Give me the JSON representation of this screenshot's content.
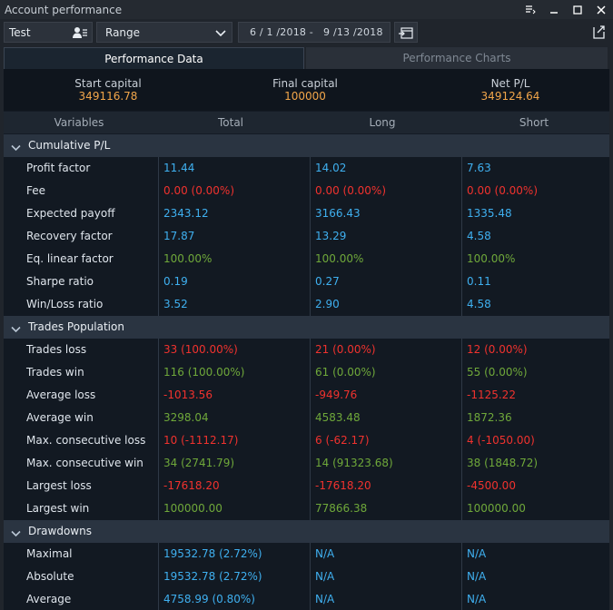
{
  "window": {
    "title": "Account performance"
  },
  "toolbar": {
    "account": "Test",
    "range_mode": "Range",
    "date_range": "6 / 1 /2018 -   9 /13 /2018"
  },
  "tabs": [
    {
      "label": "Performance Data",
      "active": true
    },
    {
      "label": "Performance Charts",
      "active": false
    }
  ],
  "summary": {
    "start_capital_label": "Start capital",
    "start_capital_value": "349116.78",
    "final_capital_label": "Final capital",
    "final_capital_value": "100000",
    "net_pl_label": "Net P/L",
    "net_pl_value": "349124.64"
  },
  "columns": [
    "Variables",
    "Total",
    "Long",
    "Short"
  ],
  "colors": {
    "blue": "#3fb0f0",
    "red": "#f0322e",
    "green": "#6fa83a",
    "orange": "#f2a64a"
  },
  "sections": [
    {
      "label": "Cumulative P/L",
      "rows": [
        {
          "name": "Profit factor",
          "total": "11.44",
          "long": "14.02",
          "short": "7.63",
          "color": "blue"
        },
        {
          "name": "Fee",
          "total": "0.00 (0.00%)",
          "long": "0.00 (0.00%)",
          "short": "0.00 (0.00%)",
          "color": "red"
        },
        {
          "name": "Expected payoff",
          "total": "2343.12",
          "long": "3166.43",
          "short": "1335.48",
          "color": "blue"
        },
        {
          "name": "Recovery factor",
          "total": "17.87",
          "long": "13.29",
          "short": "4.58",
          "color": "blue"
        },
        {
          "name": "Eq. linear factor",
          "total": "100.00%",
          "long": "100.00%",
          "short": "100.00%",
          "color": "green"
        },
        {
          "name": "Sharpe ratio",
          "total": "0.19",
          "long": "0.27",
          "short": "0.11",
          "color": "blue"
        },
        {
          "name": "Win/Loss ratio",
          "total": "3.52",
          "long": "2.90",
          "short": "4.58",
          "color": "blue"
        }
      ]
    },
    {
      "label": "Trades Population",
      "rows": [
        {
          "name": "Trades loss",
          "total": "33 (100.00%)",
          "long": "21 (0.00%)",
          "short": "12 (0.00%)",
          "color": "red"
        },
        {
          "name": "Trades win",
          "total": "116 (100.00%)",
          "long": "61 (0.00%)",
          "short": "55 (0.00%)",
          "color": "green"
        },
        {
          "name": "Average loss",
          "total": "-1013.56",
          "long": "-949.76",
          "short": "-1125.22",
          "color": "red"
        },
        {
          "name": "Average win",
          "total": "3298.04",
          "long": "4583.48",
          "short": "1872.36",
          "color": "green"
        },
        {
          "name": "Max. consecutive loss",
          "total": "10 (-1112.17)",
          "long": "6 (-62.17)",
          "short": "4 (-1050.00)",
          "color": "red"
        },
        {
          "name": "Max. consecutive win",
          "total": "34 (2741.79)",
          "long": "14 (91323.68)",
          "short": "38 (1848.72)",
          "color": "green"
        },
        {
          "name": "Largest loss",
          "total": "-17618.20",
          "long": "-17618.20",
          "short": "-4500.00",
          "color": "red"
        },
        {
          "name": "Largest win",
          "total": "100000.00",
          "long": "77866.38",
          "short": "100000.00",
          "color": "green"
        }
      ]
    },
    {
      "label": "Drawdowns",
      "rows": [
        {
          "name": "Maximal",
          "total": "19532.78 (2.72%)",
          "long": "N/A",
          "short": "N/A",
          "color": "blue"
        },
        {
          "name": "Absolute",
          "total": "19532.78 (2.72%)",
          "long": "N/A",
          "short": "N/A",
          "color": "blue"
        },
        {
          "name": "Average",
          "total": "4758.99 (0.80%)",
          "long": "N/A",
          "short": "N/A",
          "color": "blue"
        }
      ]
    }
  ]
}
